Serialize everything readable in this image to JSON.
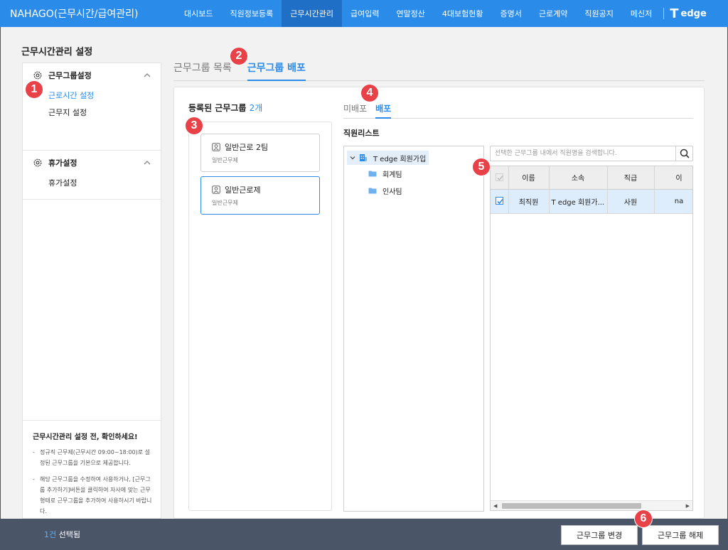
{
  "app": {
    "title": "NAHAGO(근무시간/급여관리)",
    "brand_mark": "T",
    "brand_name": "edge"
  },
  "nav": {
    "items": [
      "대시보드",
      "직원정보등록",
      "근무시간관리",
      "급여입력",
      "연말정산",
      "4대보험현황",
      "증명서",
      "근로계약",
      "직원공지",
      "메신저"
    ],
    "active_index": 2
  },
  "page": {
    "heading": "근무시간관리 설정"
  },
  "sidebar": {
    "sections": [
      {
        "label": "근무그룹설정",
        "items": [
          "근로시간 설정",
          "근무지 설정"
        ],
        "active_item": 0
      },
      {
        "label": "휴가설정",
        "items": [
          "휴가설정"
        ]
      }
    ],
    "notice": {
      "title": "근무시간관리 설정 전, 확인하세요!",
      "items": [
        "정규직 근무제(근무시간 09:00~18:00)로 설정된 근무그룹을 기본으로 제공합니다.",
        "해당 근무그룹을 수정하여 사용하거나, [근무그룹 추가하기]버튼을 클릭하여 자사에 맞는 근무형태로 근무그룹을 추가하여 사용하시기 바랍니다."
      ]
    }
  },
  "tabs": {
    "list": "근무그룹 목록",
    "deploy": "근무그룹 배포",
    "active": "deploy"
  },
  "groups": {
    "title": "등록된 근무그룹",
    "count": "2개",
    "items": [
      {
        "name": "일반근로 2팀",
        "type": "일반근무제",
        "selected": false
      },
      {
        "name": "일반근로제",
        "type": "일반근무제",
        "selected": true
      }
    ]
  },
  "subtabs": {
    "undeployed": "미배포",
    "deployed": "배포",
    "active": "deployed"
  },
  "employees": {
    "title": "직원리스트",
    "search_placeholder": "선택한 근무그룹 내에서 직원명을 검색합니다.",
    "tree": {
      "root": "T edge 회원가입",
      "children": [
        "회계팀",
        "인사팀"
      ]
    },
    "columns": [
      "이름",
      "소속",
      "직급",
      "이"
    ],
    "rows": [
      {
        "checked": true,
        "name": "최직원",
        "dept": "T edge 회원가...",
        "rank": "사원",
        "extra": "na"
      }
    ]
  },
  "bottom": {
    "selected_num": "1건",
    "selected_suffix": " 선택됨",
    "change_button": "근무그룹 변경",
    "release_button": "근무그룹 해제"
  },
  "markers": [
    "1",
    "2",
    "3",
    "4",
    "5",
    "6"
  ],
  "colors": {
    "primary": "#2a8be9",
    "nav_active": "#1f6fc6",
    "bottom_bar": "#4a5567",
    "marker": "#e84147",
    "selected_row": "#deedfb"
  }
}
